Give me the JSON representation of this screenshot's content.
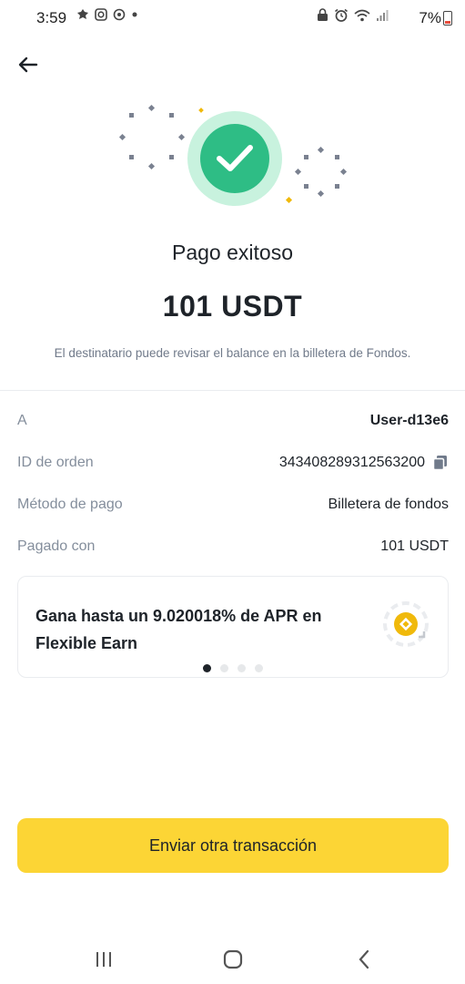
{
  "status_bar": {
    "time": "3:59",
    "battery_percent": "7%",
    "left_icons": [
      "notification-icon",
      "instagram-icon",
      "sync-icon",
      "dot-icon"
    ],
    "right_icons": [
      "lock-icon",
      "alarm-icon",
      "wifi-icon",
      "signal-icon",
      "battery-icon"
    ]
  },
  "header": {
    "back_icon": "arrow-left-icon"
  },
  "result": {
    "title": "Pago exitoso",
    "amount": "101 USDT",
    "note": "El destinatario puede revisar el balance en la billetera de Fondos.",
    "status_color": "#2ebd85"
  },
  "details": [
    {
      "label": "A",
      "value": "User-d13e6"
    },
    {
      "label": "ID de orden",
      "value": "343408289312563200"
    },
    {
      "label": "Método de pago",
      "value": "Billetera de fondos"
    },
    {
      "label": "Pagado con",
      "value": "101 USDT"
    }
  ],
  "promo": {
    "text": "Gana hasta un 9.020018% de APR en Flexible Earn",
    "page_count": 4,
    "active_page": 1
  },
  "actions": {
    "primary_label": "Enviar otra transacción",
    "primary_color": "#fcd535"
  },
  "nav": {
    "icons": [
      "recent-apps-icon",
      "home-icon",
      "back-icon"
    ]
  }
}
